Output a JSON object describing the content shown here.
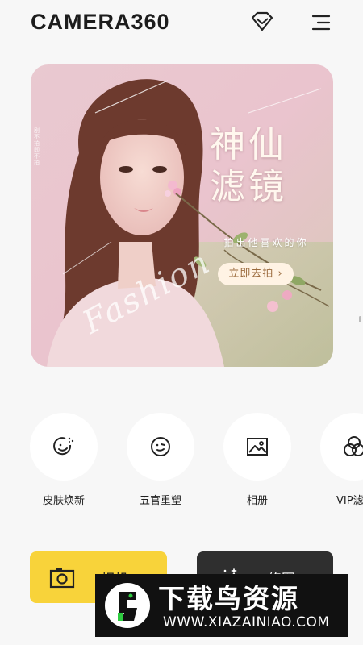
{
  "header": {
    "logo": "CAMERA360",
    "vip_icon": "diamond-icon",
    "menu_icon": "hamburger-menu-icon"
  },
  "banner": {
    "title": "神仙滤镜",
    "subtitle": "拍出他喜欢的你",
    "cta": "立即去拍 ›",
    "script_text": "Fashion",
    "vertical_text": "剧不拍即不拍"
  },
  "tools": [
    {
      "label": "皮肤焕新",
      "icon": "smile-sparkle-icon"
    },
    {
      "label": "五官重塑",
      "icon": "face-wink-icon"
    },
    {
      "label": "相册",
      "icon": "image-icon"
    },
    {
      "label": "VIP滤镜",
      "icon": "filter-circles-icon"
    }
  ],
  "buttons": {
    "camera_label": "相机",
    "camera_icon": "camera-icon",
    "edit_label": "修图",
    "edit_icon": "magic-wand-icon"
  },
  "watermark": {
    "title": "下载鸟资源",
    "url": "WWW.XIAZAINIAO.COM"
  },
  "colors": {
    "accent_yellow": "#f8d33a",
    "dark_button": "#2f2f2f",
    "background": "#f7f7f7"
  }
}
